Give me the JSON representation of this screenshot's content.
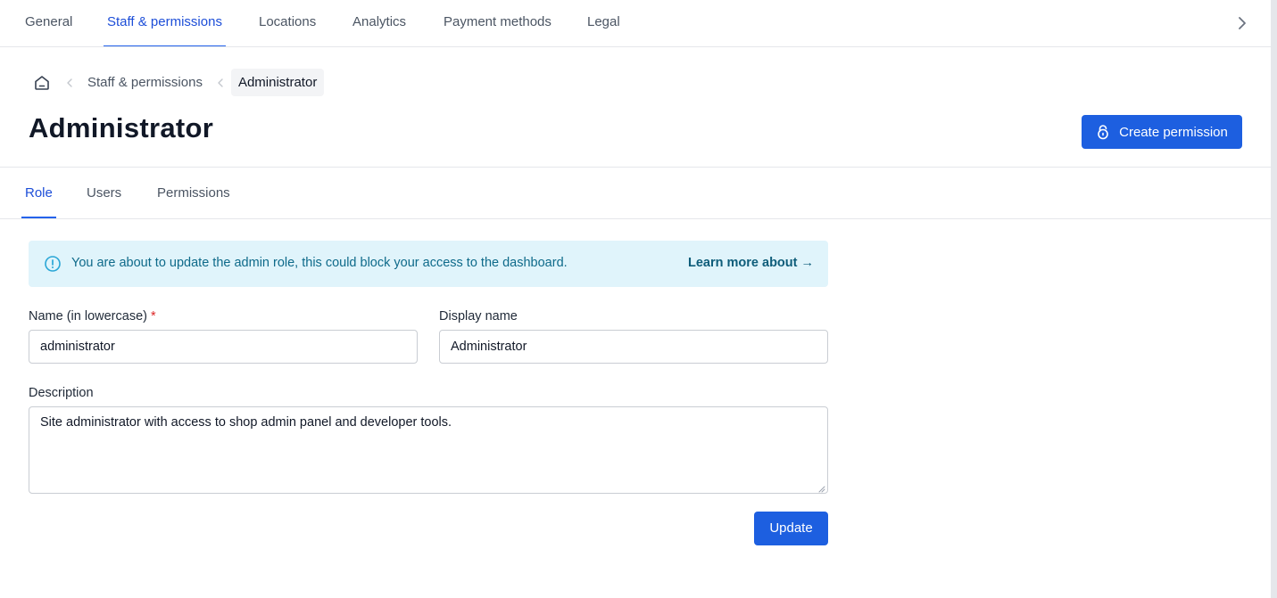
{
  "top_tabs": [
    {
      "label": "General"
    },
    {
      "label": "Staff & permissions",
      "active": true
    },
    {
      "label": "Locations"
    },
    {
      "label": "Analytics"
    },
    {
      "label": "Payment methods"
    },
    {
      "label": "Legal"
    }
  ],
  "top_tabs_scroll_icon": "chevron-right-icon",
  "breadcrumb": {
    "home_icon": "home-icon",
    "separator_icon": "chevron-left-icon",
    "items": [
      {
        "label": "Staff & permissions"
      },
      {
        "label": "Administrator",
        "current": true
      }
    ]
  },
  "header": {
    "title": "Administrator",
    "create_button": {
      "label": "Create permission",
      "icon": "lock-icon"
    }
  },
  "sub_tabs": [
    {
      "label": "Role",
      "active": true
    },
    {
      "label": "Users"
    },
    {
      "label": "Permissions"
    }
  ],
  "alert": {
    "icon": "info-circle-icon",
    "message": "You are about to update the admin role, this could block your access to the dashboard.",
    "link_label": "Learn more about →"
  },
  "form": {
    "name": {
      "label": "Name (in lowercase)",
      "required_mark": "*",
      "value": "administrator"
    },
    "display_name": {
      "label": "Display name",
      "value": "Administrator"
    },
    "description": {
      "label": "Description",
      "value": "Site administrator with access to shop admin panel and developer tools."
    },
    "submit_label": "Update"
  },
  "colors": {
    "accent": "#1d5fe0",
    "alert_background": "#e0f4fb",
    "alert_text": "#0e6a8a",
    "required": "#dc2626"
  }
}
